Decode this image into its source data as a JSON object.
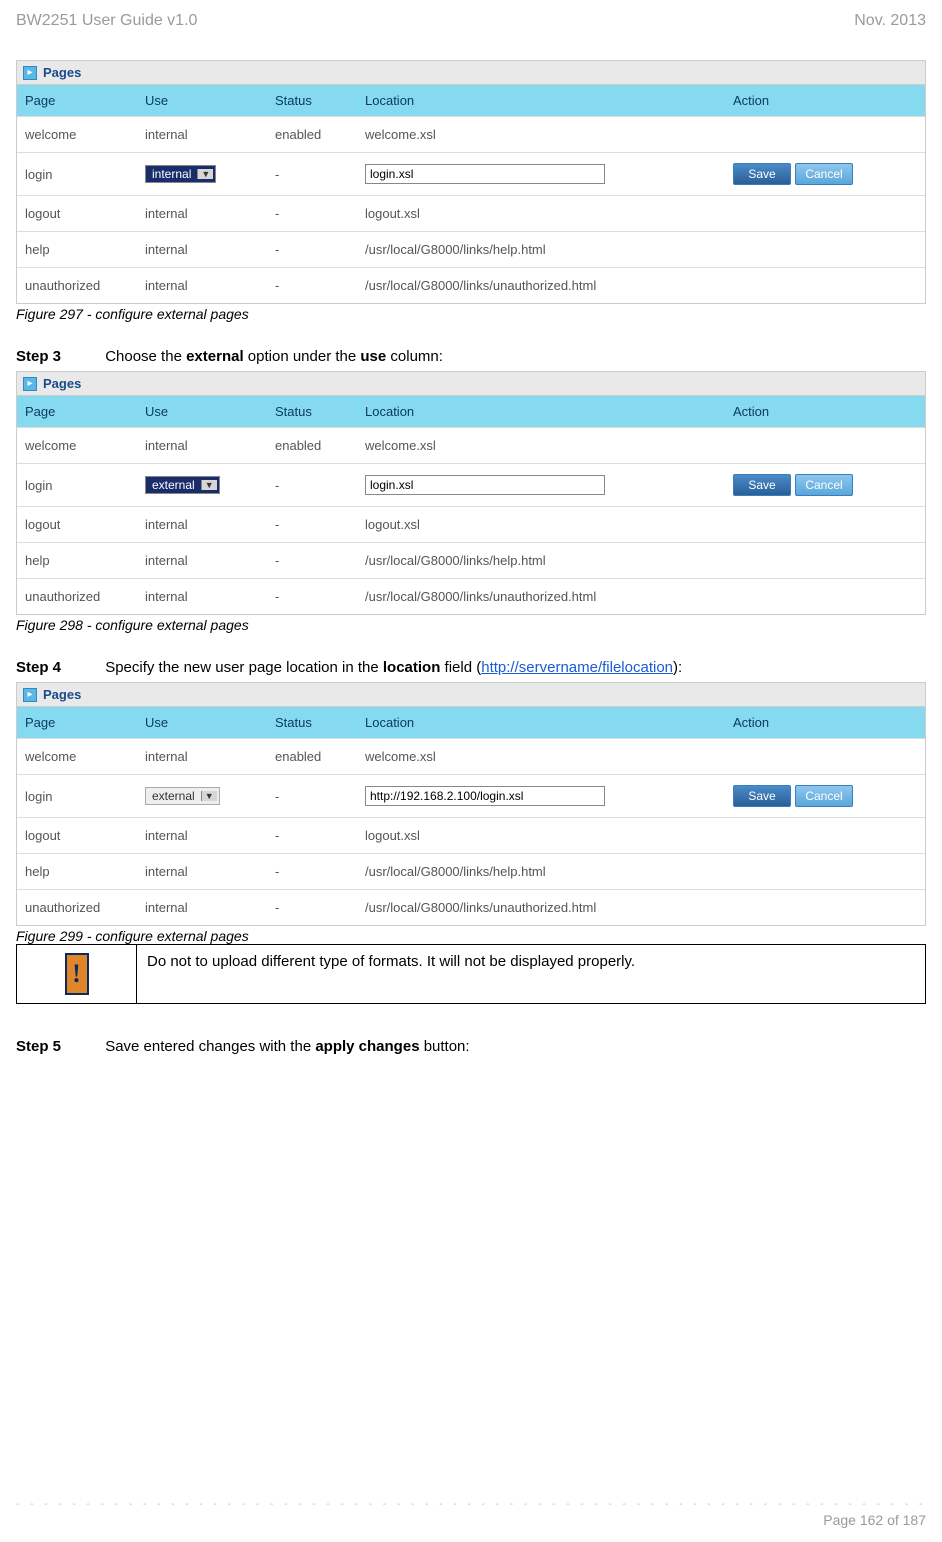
{
  "doc": {
    "header_left": "BW2251 User Guide v1.0",
    "header_right": "Nov.  2013",
    "footer_page": "Page 162 of 187",
    "panel_title": "Pages",
    "columns": {
      "page": "Page",
      "use": "Use",
      "status": "Status",
      "location": "Location",
      "action": "Action"
    },
    "btn_save": "Save",
    "btn_cancel": "Cancel",
    "warn_text": "Do not to upload different type of formats. It will not be displayed properly.",
    "warn_glyph": "!"
  },
  "fig297": {
    "caption": "Figure 297 - configure external pages",
    "rows": [
      {
        "page": "welcome",
        "use": "internal",
        "status": "enabled",
        "location": "welcome.xsl",
        "editable": false
      },
      {
        "page": "login",
        "use_select": "internal",
        "use_highlight": true,
        "status": "-",
        "location": "login.xsl",
        "editable": true,
        "btn_style": "dark"
      },
      {
        "page": "logout",
        "use": "internal",
        "status": "-",
        "location": "logout.xsl",
        "editable": false
      },
      {
        "page": "help",
        "use": "internal",
        "status": "-",
        "location": "/usr/local/G8000/links/help.html",
        "editable": false
      },
      {
        "page": "unauthorized",
        "use": "internal",
        "status": "-",
        "location": "/usr/local/G8000/links/unauthorized.html",
        "editable": false
      }
    ]
  },
  "step3": {
    "label": "Step 3",
    "text_before": "Choose the ",
    "bold1": "external",
    "text_mid": " option under the ",
    "bold2": "use",
    "text_after": " column:"
  },
  "fig298": {
    "caption": "Figure 298 - configure external pages",
    "rows": [
      {
        "page": "welcome",
        "use": "internal",
        "status": "enabled",
        "location": "welcome.xsl",
        "editable": false
      },
      {
        "page": "login",
        "use_select": "external",
        "use_highlight": true,
        "status": "-",
        "location": "login.xsl",
        "editable": true,
        "btn_style": "dark"
      },
      {
        "page": "logout",
        "use": "internal",
        "status": "-",
        "location": "logout.xsl",
        "editable": false
      },
      {
        "page": "help",
        "use": "internal",
        "status": "-",
        "location": "/usr/local/G8000/links/help.html",
        "editable": false
      },
      {
        "page": "unauthorized",
        "use": "internal",
        "status": "-",
        "location": "/usr/local/G8000/links/unauthorized.html",
        "editable": false
      }
    ]
  },
  "step4": {
    "label": "Step 4",
    "text_before": "Specify the new user page location in the ",
    "bold1": "location",
    "text_mid": " field (",
    "link_text": "http://servername/filelocation",
    "text_after": "):"
  },
  "fig299": {
    "caption": "Figure 299 - configure external pages",
    "rows": [
      {
        "page": "welcome",
        "use": "internal",
        "status": "enabled",
        "location": "welcome.xsl",
        "editable": false
      },
      {
        "page": "login",
        "use_select": "external",
        "use_highlight": false,
        "status": "-",
        "location": "http://192.168.2.100/login.xsl",
        "editable": true,
        "btn_style": "dark"
      },
      {
        "page": "logout",
        "use": "internal",
        "status": "-",
        "location": "logout.xsl",
        "editable": false
      },
      {
        "page": "help",
        "use": "internal",
        "status": "-",
        "location": "/usr/local/G8000/links/help.html",
        "editable": false
      },
      {
        "page": "unauthorized",
        "use": "internal",
        "status": "-",
        "location": "/usr/local/G8000/links/unauthorized.html",
        "editable": false
      }
    ]
  },
  "step5": {
    "label": "Step 5",
    "text_before": "Save entered changes with the ",
    "bold1": "apply changes",
    "text_after": " button:"
  }
}
